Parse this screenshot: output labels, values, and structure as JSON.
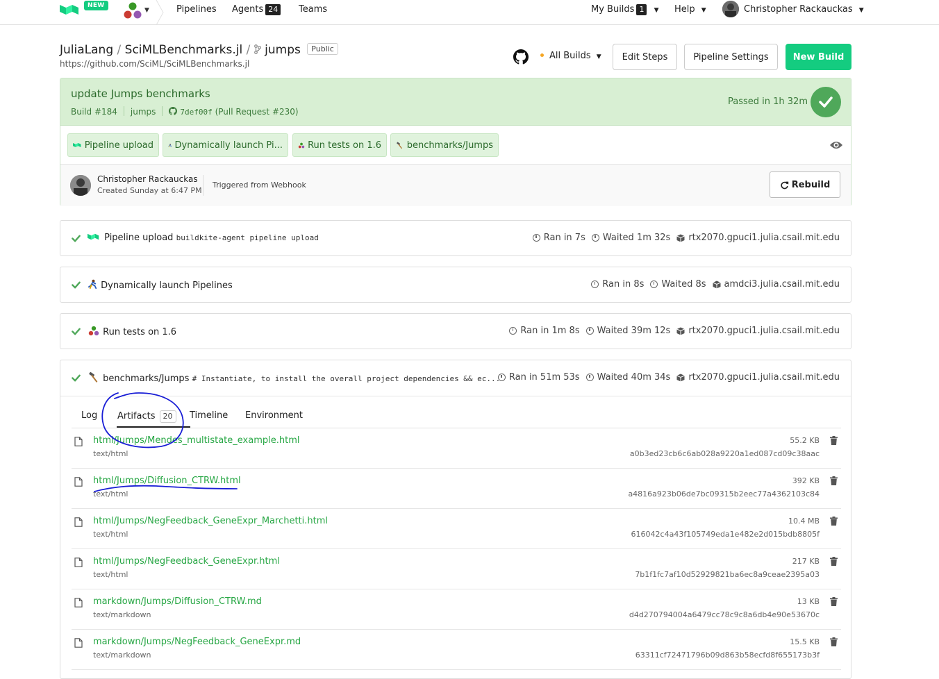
{
  "nav": {
    "new_badge": "NEW",
    "pipelines": "Pipelines",
    "agents": "Agents",
    "agents_count": "24",
    "teams": "Teams",
    "my_builds": "My Builds",
    "my_builds_count": "1",
    "help": "Help",
    "user": "Christopher Rackauckas"
  },
  "header": {
    "org": "JuliaLang",
    "repo": "SciMLBenchmarks.jl",
    "branch": "jumps",
    "visibility": "Public",
    "url": "https://github.com/SciML/SciMLBenchmarks.jl",
    "all_builds": "All Builds",
    "edit_steps": "Edit Steps",
    "pipeline_settings": "Pipeline Settings",
    "new_build": "New Build"
  },
  "build": {
    "title": "update Jumps benchmarks",
    "number": "Build #184",
    "branch": "jumps",
    "commit": "7def00f",
    "pr": "(Pull Request #230)",
    "status": "Passed in 1h 32m",
    "steps": [
      {
        "label": "Pipeline upload",
        "icon": "buildkite-icon"
      },
      {
        "label": "Dynamically launch Pi...",
        "icon": "runner-emoji-icon"
      },
      {
        "label": "Run tests on 1.6",
        "icon": "julia-dots-icon"
      },
      {
        "label": "benchmarks/Jumps",
        "icon": "hammer-icon"
      }
    ],
    "creator": "Christopher Rackauckas",
    "created": "Created Sunday at 6:47 PM",
    "trigger": "Triggered from Webhook",
    "rebuild": "Rebuild"
  },
  "jobs": [
    {
      "name": "Pipeline upload",
      "cmd": "buildkite-agent pipeline upload",
      "ran": "Ran in 7s",
      "waited": "Waited 1m 32s",
      "agent": "rtx2070.gpuci1.julia.csail.mit.edu"
    },
    {
      "name": "Dynamically launch Pipelines",
      "cmd": "",
      "ran": "Ran in 8s",
      "waited": "Waited 8s",
      "agent": "amdci3.julia.csail.mit.edu"
    },
    {
      "name": "Run tests on 1.6",
      "cmd": "",
      "ran": "Ran in 1m 8s",
      "waited": "Waited 39m 12s",
      "agent": "rtx2070.gpuci1.julia.csail.mit.edu"
    },
    {
      "name": "benchmarks/Jumps",
      "cmd": "# Instantiate, to install the overall project dependencies && ec...",
      "ran": "Ran in 51m 53s",
      "waited": "Waited 40m 34s",
      "agent": "rtx2070.gpuci1.julia.csail.mit.edu"
    }
  ],
  "tabs": {
    "log": "Log",
    "artifacts": "Artifacts",
    "artifacts_count": "20",
    "timeline": "Timeline",
    "environment": "Environment"
  },
  "artifacts": [
    {
      "name": "html/Jumps/Mendes_multistate_example.html",
      "type": "text/html",
      "size": "55.2 KB",
      "hash": "a0b3ed23cb6c6ab028a9220a1ed087cd09c38aac"
    },
    {
      "name": "html/Jumps/Diffusion_CTRW.html",
      "type": "text/html",
      "size": "392 KB",
      "hash": "a4816a923b06de7bc09315b2eec77a4362103c84"
    },
    {
      "name": "html/Jumps/NegFeedback_GeneExpr_Marchetti.html",
      "type": "text/html",
      "size": "10.4 MB",
      "hash": "616042c4a43f105749eda1e482e2d015bdb8805f"
    },
    {
      "name": "html/Jumps/NegFeedback_GeneExpr.html",
      "type": "text/html",
      "size": "217 KB",
      "hash": "7b1f1fc7af10d52929821ba6ec8a9ceae2395a03"
    },
    {
      "name": "markdown/Jumps/Diffusion_CTRW.md",
      "type": "text/markdown",
      "size": "13 KB",
      "hash": "d4d270794004a6479cc78c9c8a6db4e90e53670c"
    },
    {
      "name": "markdown/Jumps/NegFeedback_GeneExpr.md",
      "type": "text/markdown",
      "size": "15.5 KB",
      "hash": "63311cf72471796b09d863b58ecfd8f655173b3f"
    }
  ],
  "colors": {
    "brand_green": "#14cc80",
    "passed_bg": "#d8efd3",
    "link_green": "#28a745",
    "annotation_blue": "#1a1fd6"
  }
}
